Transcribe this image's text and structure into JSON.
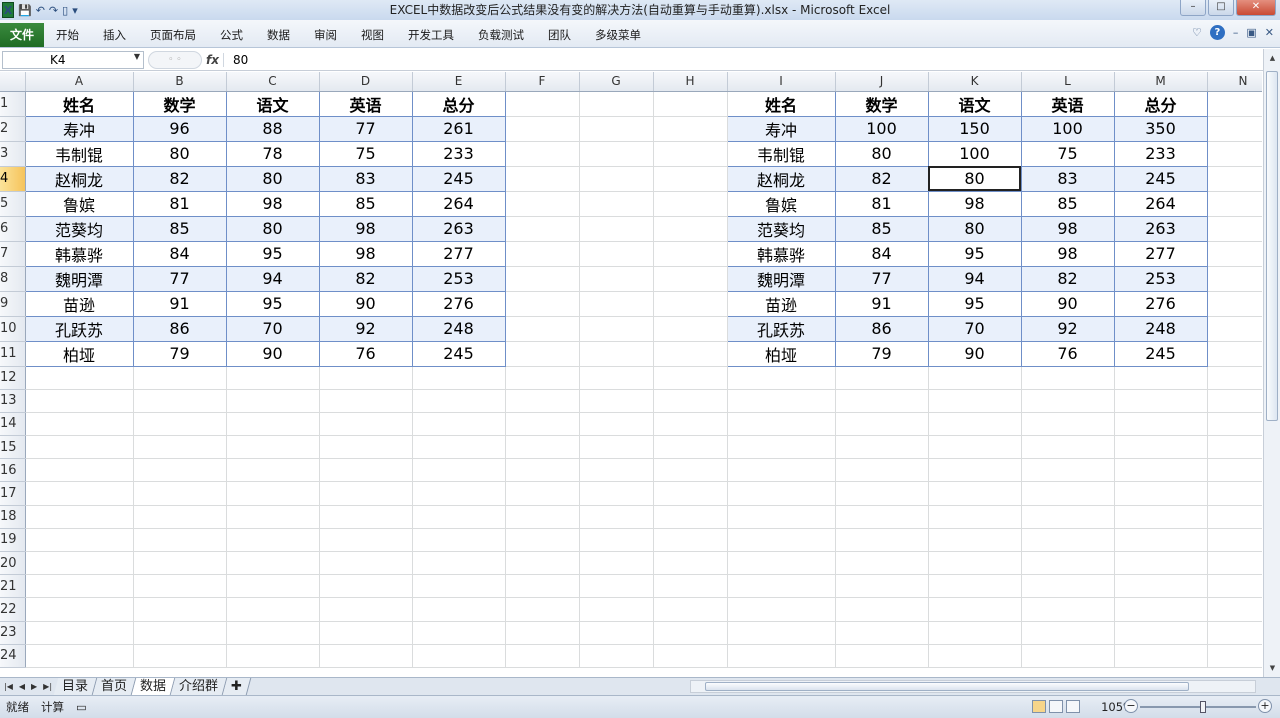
{
  "window": {
    "title": "EXCEL中数据改变后公式结果没有变的解决方法(自动重算与手动重算).xlsx - Microsoft Excel",
    "min": "–",
    "max": "□",
    "close": "✕"
  },
  "ribbon": {
    "file": "文件",
    "tabs": [
      "开始",
      "插入",
      "页面布局",
      "公式",
      "数据",
      "审阅",
      "视图",
      "开发工具",
      "负载测试",
      "团队",
      "多级菜单"
    ]
  },
  "formula_bar": {
    "name_box": "K4",
    "fx": "fx",
    "value": "80"
  },
  "grid": {
    "columns": [
      "A",
      "B",
      "C",
      "D",
      "E",
      "F",
      "G",
      "H",
      "I",
      "J",
      "K",
      "L",
      "M",
      "N"
    ],
    "rows": [
      "1",
      "2",
      "3",
      "4",
      "5",
      "6",
      "7",
      "8",
      "9",
      "10",
      "11",
      "12",
      "13",
      "14",
      "15",
      "16",
      "17",
      "18",
      "19",
      "20",
      "21",
      "22",
      "23",
      "24"
    ],
    "selected_column": "K",
    "selected_row": "4",
    "table_left": {
      "headers": [
        "姓名",
        "数学",
        "语文",
        "英语",
        "总分"
      ],
      "rows": [
        [
          "寿冲",
          "96",
          "88",
          "77",
          "261"
        ],
        [
          "韦制锟",
          "80",
          "78",
          "75",
          "233"
        ],
        [
          "赵桐龙",
          "82",
          "80",
          "83",
          "245"
        ],
        [
          "鲁嫔",
          "81",
          "98",
          "85",
          "264"
        ],
        [
          "范葵均",
          "85",
          "80",
          "98",
          "263"
        ],
        [
          "韩慕骅",
          "84",
          "95",
          "98",
          "277"
        ],
        [
          "魏明潭",
          "77",
          "94",
          "82",
          "253"
        ],
        [
          "苗逊",
          "91",
          "95",
          "90",
          "276"
        ],
        [
          "孔跃苏",
          "86",
          "70",
          "92",
          "248"
        ],
        [
          "柏垭",
          "79",
          "90",
          "76",
          "245"
        ]
      ]
    },
    "table_right": {
      "headers": [
        "姓名",
        "数学",
        "语文",
        "英语",
        "总分"
      ],
      "rows": [
        [
          "寿冲",
          "100",
          "150",
          "100",
          "350"
        ],
        [
          "韦制锟",
          "80",
          "100",
          "75",
          "233"
        ],
        [
          "赵桐龙",
          "82",
          "80",
          "83",
          "245"
        ],
        [
          "鲁嫔",
          "81",
          "98",
          "85",
          "264"
        ],
        [
          "范葵均",
          "85",
          "80",
          "98",
          "263"
        ],
        [
          "韩慕骅",
          "84",
          "95",
          "98",
          "277"
        ],
        [
          "魏明潭",
          "77",
          "94",
          "82",
          "253"
        ],
        [
          "苗逊",
          "91",
          "95",
          "90",
          "276"
        ],
        [
          "孔跃苏",
          "86",
          "70",
          "92",
          "248"
        ],
        [
          "柏垭",
          "79",
          "90",
          "76",
          "245"
        ]
      ]
    }
  },
  "sheets": {
    "tabs": [
      "目录",
      "首页",
      "数据",
      "介绍群"
    ],
    "active": "数据"
  },
  "status": {
    "ready": "就绪",
    "calc": "计算",
    "zoom": "105%"
  }
}
